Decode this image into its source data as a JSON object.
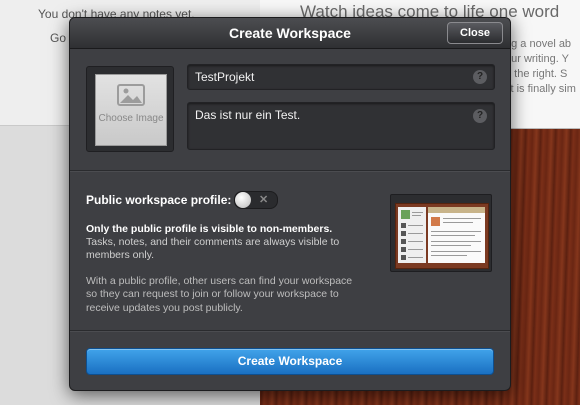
{
  "background": {
    "left_empty_text": "You don't have any notes yet.",
    "left_go_text": "Go",
    "right_headline": "Watch ideas come to life one word",
    "right_lines": [
      "ng a novel ab",
      "our writing. Y",
      "n the right. S",
      "kt is finally sim"
    ]
  },
  "dialog": {
    "title": "Create Workspace",
    "close_label": "Close",
    "image_button_label": "Choose Image",
    "name_value": "TestProjekt",
    "description_value": "Das ist nur ein Test.",
    "help_glyph": "?",
    "public_profile_label": "Public workspace profile:",
    "toggle_off_glyph": "✕",
    "info_bold": "Only the public profile is visible to non-members.",
    "info_rest": "Tasks, notes, and their comments are always visible to members only.",
    "info_secondary": "With a public profile, other users can find your workspace so they can request to join or follow your workspace to receive updates you post publicly.",
    "submit_label": "Create Workspace"
  },
  "colors": {
    "accent": "#2a8ad6",
    "dialog_bg": "#3e3f43",
    "wood": "#6a2613"
  }
}
